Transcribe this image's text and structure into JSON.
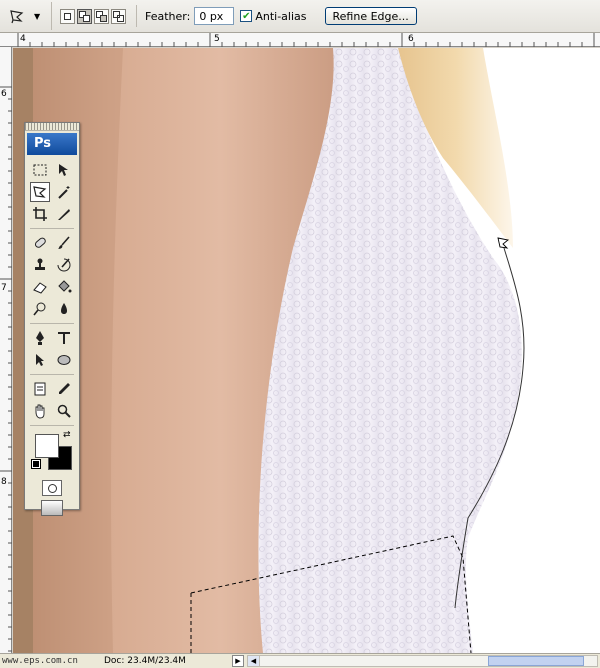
{
  "options_bar": {
    "tool_preset_icon": "polygonal-lasso-icon",
    "selection_modes": [
      "new-selection",
      "add-to-selection",
      "subtract-from-selection",
      "intersect-selection"
    ],
    "active_mode_index": 1,
    "feather_label": "Feather:",
    "feather_value": "0 px",
    "anti_alias_label": "Anti-alias",
    "anti_alias_checked": true,
    "refine_edge_label": "Refine Edge..."
  },
  "ruler": {
    "top_labels": [
      "4",
      "5",
      "6"
    ],
    "left_labels": [
      "6",
      "7",
      "8"
    ]
  },
  "toolbox": {
    "logo": "Ps",
    "rows": [
      [
        "rect-marquee-icon",
        "move-icon"
      ],
      [
        "polygonal-lasso-icon",
        "magic-wand-icon"
      ],
      [
        "crop-icon",
        "slice-icon"
      ],
      [
        "healing-brush-icon",
        "brush-icon"
      ],
      [
        "clone-stamp-icon",
        "history-brush-icon"
      ],
      [
        "eraser-icon",
        "paint-bucket-icon"
      ],
      [
        "dodge-icon",
        "blur-icon"
      ],
      [
        "pen-icon",
        "type-icon"
      ],
      [
        "path-select-icon",
        "ellipse-icon"
      ],
      [
        "notes-icon",
        "eyedropper-icon"
      ],
      [
        "hand-icon",
        "zoom-icon"
      ]
    ],
    "active_tool": "polygonal-lasso-icon",
    "foreground_color": "#ffffff",
    "background_color": "#000000"
  },
  "status": {
    "watermark": "www.eps.com.cn",
    "doc_label": "Doc: 23.4M/23.4M"
  },
  "colors": {
    "ui_bg": "#ece9d8",
    "accent": "#0f4a9c"
  }
}
